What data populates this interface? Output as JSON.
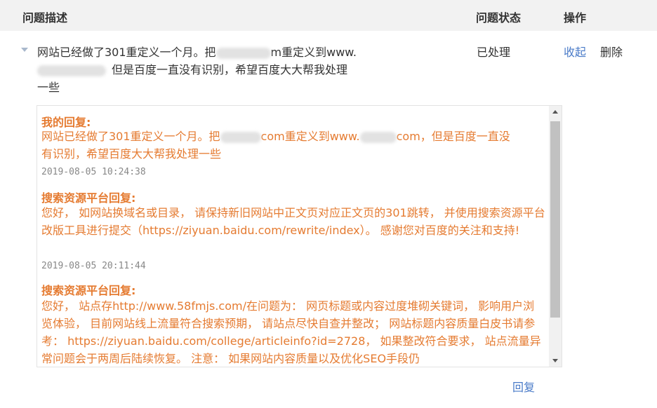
{
  "header": {
    "col_description": "问题描述",
    "col_status": "问题状态",
    "col_action": "操作"
  },
  "issue": {
    "line1_start": "网站已经做了301重定义一个月。把",
    "line1_mid": "m重定义到www.",
    "line2_end": "但是百度一直没有识别，希望百度大大帮我处理",
    "line3": "一些",
    "status": "已处理",
    "collapse_label": "收起",
    "delete_label": "删除"
  },
  "replies": [
    {
      "title": "我的回复:",
      "body_line1_a": "网站已经做了301重定义一个月。把",
      "body_line1_b": "com重定义到www.",
      "body_line1_c": "com，但是百度一直没",
      "body_line2": "有识别，希望百度大大帮我处理一些",
      "time": "2019-08-05 10:24:38"
    },
    {
      "title": "搜索资源平台回复:",
      "body": "您好， 如网站换域名或目录， 请保持新旧网站中正文页对应正文页的301跳转， 并使用搜索资源平台改版工具进行提交（https://ziyuan.baidu.com/rewrite/index）。 感谢您对百度的关注和支持!",
      "time": "2019-08-05 20:11:44"
    },
    {
      "title": "搜索资源平台回复:",
      "body": "您好， 站点存http://www.58fmjs.com/在问题为： 网页标题或内容过度堆砌关键词， 影响用户浏览体验， 目前网站线上流量符合搜索预期， 请站点尽快自查并整改； 网站标题内容质量白皮书请参考： https://ziyuan.baidu.com/college/articleinfo?id=2728， 如果整改符合要求， 站点流量异常问题会于两周后陆续恢复。 注意： 如果网站内容质量以及优化SEO手段仍"
    }
  ],
  "reply_button": "回复"
}
